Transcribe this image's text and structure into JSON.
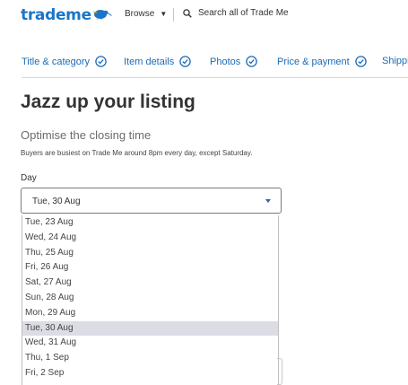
{
  "header": {
    "logo": "trademe",
    "browse_label": "Browse",
    "search_label": "Search all of Trade Me"
  },
  "steps": [
    {
      "label": "Title & category"
    },
    {
      "label": "Item details"
    },
    {
      "label": "Photos"
    },
    {
      "label": "Price & payment"
    },
    {
      "label": "Shippi"
    }
  ],
  "page": {
    "title": "Jazz up your listing",
    "subtitle": "Optimise the closing time",
    "hint": "Buyers are busiest on Trade Me around 8pm every day, except Saturday.",
    "day_label": "Day"
  },
  "day_select": {
    "selected": "Tue, 30 Aug",
    "options": [
      "Tue, 23 Aug",
      "Wed, 24 Aug",
      "Thu, 25 Aug",
      "Fri, 26 Aug",
      "Sat, 27 Aug",
      "Sun, 28 Aug",
      "Mon, 29 Aug",
      "Tue, 30 Aug",
      "Wed, 31 Aug",
      "Thu, 1 Sep",
      "Fri, 2 Sep"
    ]
  },
  "colors": {
    "brand_blue": "#1a75c7",
    "step_blue": "#1a6bb8",
    "selected_option_bg": "#dcdce4"
  }
}
